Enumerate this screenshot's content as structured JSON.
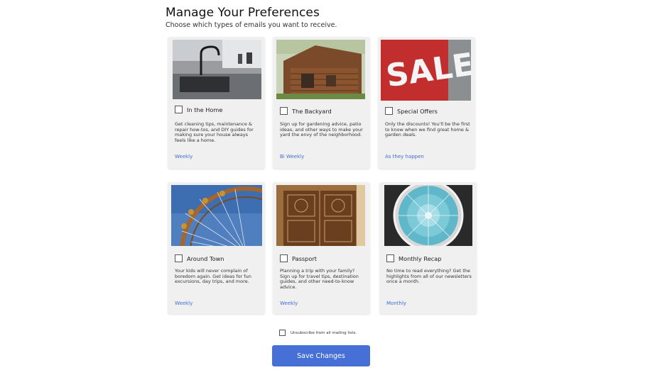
{
  "page": {
    "title": "Manage Your Preferences",
    "subtitle": "Choose which types of emails you want to receive."
  },
  "cards": [
    {
      "title": "In the Home",
      "description": "Get cleaning tips, maintenance & repair how-tos, and DIY guides for making sure your house always feels like a home.",
      "frequency": "Weekly",
      "image": "kitchen-sink-faucet-photo",
      "checked": false
    },
    {
      "title": "The Backyard",
      "description": "Sign up for gardening advice, patio ideas, and other ways to make your yard the envy of the neighborhood.",
      "frequency": "Bi Weekly",
      "image": "wooden-cabin-photo",
      "checked": false
    },
    {
      "title": "Special Offers",
      "description": "Only the discounts! You'll be the first to know when we find great home & garden deals.",
      "frequency": "As they happen",
      "image": "sale-sign-photo",
      "checked": false
    },
    {
      "title": "Around Town",
      "description": "Your kids will never complain of boredom again. Get ideas for fun excursions, day trips, and more.",
      "frequency": "Weekly",
      "image": "ferris-wheel-photo",
      "checked": false
    },
    {
      "title": "Passport",
      "description": "Planning a trip with your family? Sign up for travel tips, destination guides, and other need-to-know advice.",
      "frequency": "Weekly",
      "image": "ornate-doors-photo",
      "checked": false
    },
    {
      "title": "Monthly Recap",
      "description": "No time to read everything? Get the highlights from all of our newsletters once a month.",
      "frequency": "Monthly",
      "image": "glass-dome-ceiling-photo",
      "checked": false
    }
  ],
  "unsubscribe": {
    "label": "Unsubscribe from all mailing lists.",
    "checked": false
  },
  "actions": {
    "save_label": "Save Changes"
  },
  "colors": {
    "accent": "#4670d6",
    "link": "#3f6fd6",
    "card_bg": "#f0f0f0"
  }
}
